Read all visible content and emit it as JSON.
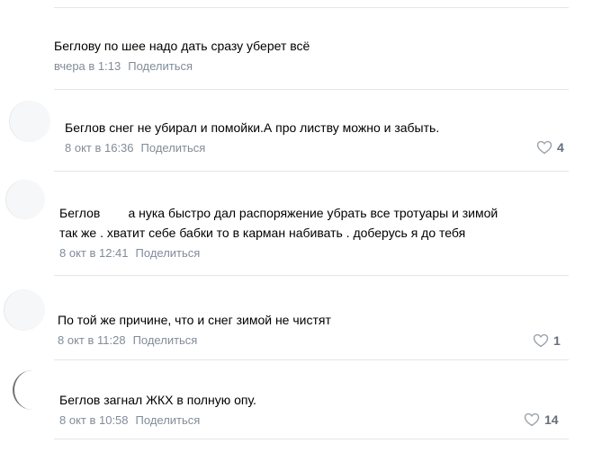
{
  "comments": [
    {
      "text": "Беглову по шее надо дать сразу уберет всё",
      "time": "вчера в 1:13",
      "share": "Поделиться",
      "likes": ""
    },
    {
      "text": "Беглов снег не убирал и помойки.А про листву можно и забыть.",
      "time": "8 окт в 16:36",
      "share": "Поделиться",
      "likes": "4"
    },
    {
      "text": "Беглов        а нука быстро дал распоряжение убрать все тротуары и зимой\nтак же . хватит себе бабки то в карман набивать . доберусь я до тебя",
      "time": "8 окт в 12:41",
      "share": "Поделиться",
      "likes": ""
    },
    {
      "text": "По той же причине, что и снег зимой не чистят",
      "time": "8 окт в 11:28",
      "share": "Поделиться",
      "likes": "1"
    },
    {
      "text": "Беглов загнал ЖКХ в полную опу.",
      "time": "8 окт в 10:58",
      "share": "Поделиться",
      "likes": "14"
    }
  ],
  "colors": {
    "text": "#000000",
    "meta": "#818c99",
    "divider": "#e3e6ea",
    "background": "#ffffff"
  },
  "icons": {
    "like": "heart-icon"
  }
}
